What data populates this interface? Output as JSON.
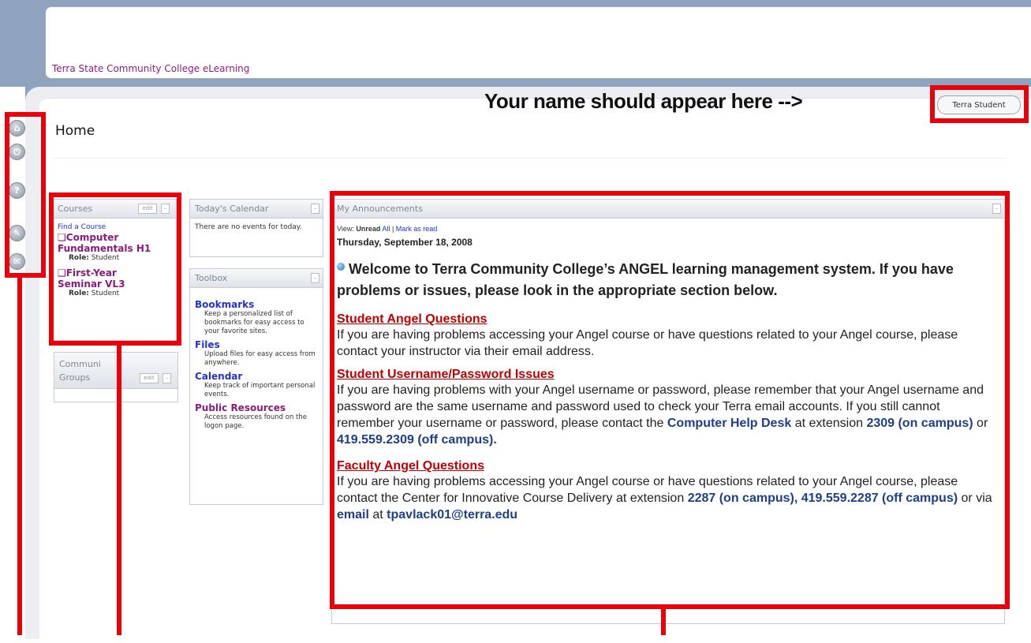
{
  "header": {
    "site_title": "Terra State Community College eLearning"
  },
  "page": {
    "title": "Home"
  },
  "callout": {
    "text": "Your name should appear here -->"
  },
  "user": {
    "name": "Terra Student"
  },
  "rail": {
    "icons": [
      {
        "name": "home-icon",
        "glyph": "⌂"
      },
      {
        "name": "power-icon",
        "glyph": "⏻"
      },
      {
        "name": "help-icon",
        "glyph": "?"
      },
      {
        "name": "wrench-icon",
        "glyph": "✎"
      },
      {
        "name": "chat-icon",
        "glyph": "✉"
      }
    ]
  },
  "courses": {
    "title": "Courses",
    "edit": "edit",
    "min": "–",
    "find": "Find a Course",
    "items": [
      {
        "bullet": "❑",
        "line1": "Computer",
        "line2": "Fundamentals H1",
        "role_label": "Role:",
        "role": "Student"
      },
      {
        "bullet": "❑",
        "line1": "First-Year",
        "line2": "Seminar VL3",
        "role_label": "Role:",
        "role": "Student"
      }
    ]
  },
  "communities": {
    "title_line1": "Communi",
    "title_line2": "Groups",
    "edit": "edit",
    "min": "–"
  },
  "calendar": {
    "title": "Today's Calendar",
    "min": "–",
    "text": "There are no events for today."
  },
  "toolbox": {
    "title": "Toolbox",
    "min": "–",
    "items": [
      {
        "title": "Bookmarks",
        "desc": "Keep a personalized list of bookmarks for easy access to your favorite sites."
      },
      {
        "title": "Files",
        "desc": "Upload files for easy access from anywhere."
      },
      {
        "title": "Calendar",
        "desc": "Keep track of important personal events."
      },
      {
        "title": "Public Resources",
        "desc": "Access resources found on the logon page."
      }
    ]
  },
  "announcements": {
    "title": "My Announcements",
    "min": "–",
    "view_label": "View:",
    "view_unread": "Unread",
    "view_all": "All",
    "sep": "|",
    "mark_read": "Mark as read",
    "date": "Thursday, September 18, 2008",
    "welcome": "Welcome to Terra Community College’s ANGEL learning management system. If you have problems or issues, please look in the appropriate section below.",
    "section1_title": "Student Angel Questions",
    "section1_text": "If you are having problems accessing your Angel course or have questions related to your Angel course, please contact your instructor via their email address.",
    "section2_title": "Student Username/Password Issues",
    "section2_text": "If you are having problems with your Angel username or password, please remember that your Angel username and password are the same username and password used to check your Terra email accounts. If you still cannot remember your username or password, please contact the",
    "section2_help": "Computer Help Desk",
    "section2_mid": "at extension",
    "section2_ext": "2309 (on campus)",
    "section2_or": "or",
    "section2_phone": "419.559.2309 (off campus).",
    "section3_title": "Faculty Angel Questions",
    "section3_text": "If you are having problems accessing your Angel course or have questions related to your Angel course, please contact the Center for Innovative Course Delivery at extension",
    "section3_ext": "2287 (on campus), 419.559.2287 (off campus)",
    "section3_or": "or via",
    "section3_email": "email",
    "section3_at": "at",
    "section3_addr": "tpavlack01@terra.edu"
  },
  "colors": {
    "highlight": "#e8000b",
    "link": "#2233cc",
    "course": "#8a1c7c",
    "heading_red": "#c00000"
  }
}
